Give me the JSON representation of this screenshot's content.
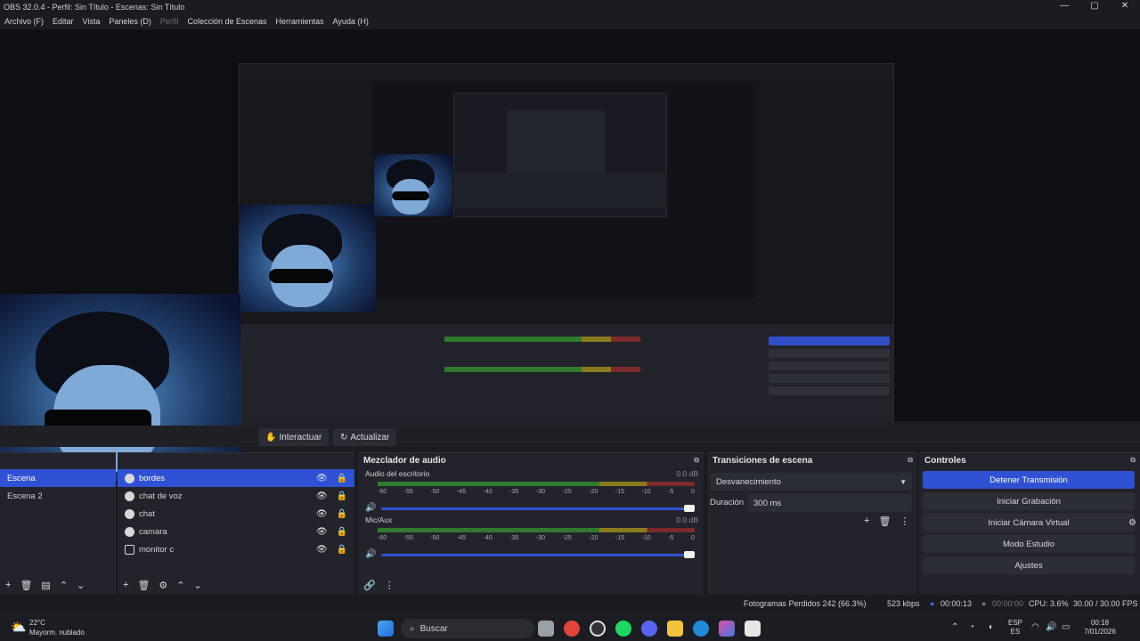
{
  "window": {
    "title": "OBS 32.0.4 - Perfil: Sin Título - Escenas: Sin Título",
    "minimize": "—",
    "maximize": "▢",
    "close": "✕"
  },
  "menu": [
    "Archivo (F)",
    "Editar",
    "Vista",
    "Paneles (D)",
    "Perfil",
    "Colección de Escenas",
    "Herramientas",
    "Ayuda (H)"
  ],
  "toolbar": {
    "interact_label": "Interactuar",
    "refresh_label": "Actualizar"
  },
  "scenes": {
    "items": [
      "Escena",
      "Escena 2"
    ]
  },
  "sources": {
    "items": [
      {
        "label": "bordes",
        "icon": "globe-icon",
        "selected": true
      },
      {
        "label": "chat de voz",
        "icon": "globe-icon",
        "selected": false
      },
      {
        "label": "chat",
        "icon": "globe-icon",
        "selected": false
      },
      {
        "label": "camara",
        "icon": "camera-icon",
        "selected": false
      },
      {
        "label": "monitor c",
        "icon": "monitor-icon",
        "selected": false
      }
    ]
  },
  "mixer": {
    "title": "Mezclador de audio",
    "channels": [
      {
        "name": "Audio del escritorio",
        "db": "0.0 dB",
        "level": 0.92
      },
      {
        "name": "Mic/Aux",
        "db": "0.0 dB",
        "level": 0.92
      }
    ],
    "ticks": [
      "-60",
      "-55",
      "-50",
      "-45",
      "-40",
      "-35",
      "-30",
      "-25",
      "-20",
      "-15",
      "-10",
      "-5",
      "0"
    ]
  },
  "transitions": {
    "title": "Transiciones de escena",
    "selected": "Desvanecimiento",
    "duration_label": "Duración",
    "duration_value": "300 ms"
  },
  "controls": {
    "title": "Controles",
    "buttons": [
      "Detener Transmisión",
      "Iniciar Grabación",
      "Iniciar Cámara Virtual",
      "Modo Estudio",
      "Ajustes"
    ]
  },
  "status": {
    "dropped": "Fotogramas Perdidos 242 (66.3%)",
    "kbps": "523 kbps",
    "stream_time": "00:00:13",
    "rec_time": "00:00:00",
    "cpu": "CPU: 3.6%",
    "fps": "30.00 / 30.00 FPS"
  },
  "taskbar": {
    "weather_temp": "22°C",
    "weather_desc": "Mayorm. nublado",
    "search_placeholder": "Buscar",
    "lang1": "ESP",
    "lang2": "ES",
    "time": "00:18",
    "date": "7/01/2026"
  },
  "colors": {
    "accent": "#2f52d4",
    "background": "#1b1c20",
    "dock": "#23242b"
  }
}
